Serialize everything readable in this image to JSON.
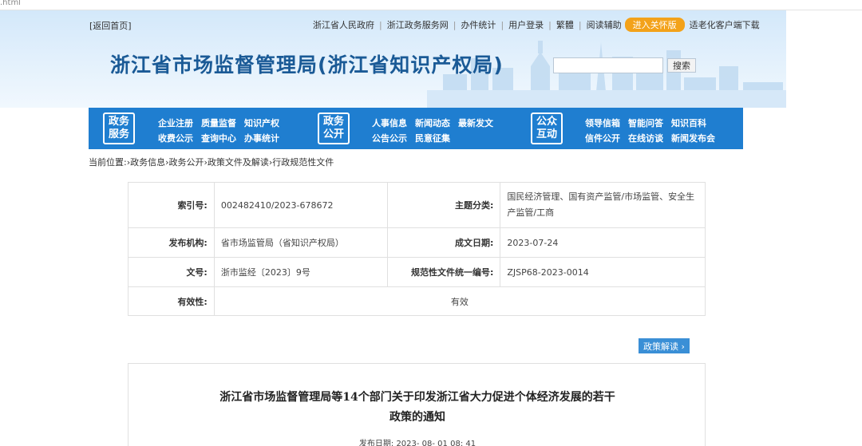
{
  "url_fragment": ".html",
  "header": {
    "back_home": "[返回首页]",
    "links": [
      "浙江省人民政府",
      "浙江政务服务网",
      "办件统计",
      "用户登录",
      "繁體",
      "阅读辅助"
    ],
    "care_mode": "进入关怀版",
    "client_download": "适老化客户端下载",
    "site_title": "浙江省市场监督管理局(浙江省知识产权局)",
    "search_placeholder": "",
    "search_button": "搜索"
  },
  "nav": {
    "groups": [
      {
        "badge_line1": "政务",
        "badge_line2": "服务",
        "row1": [
          "企业注册",
          "质量监督",
          "知识产权"
        ],
        "row2": [
          "收费公示",
          "查询中心",
          "办事统计"
        ]
      },
      {
        "badge_line1": "政务",
        "badge_line2": "公开",
        "row1": [
          "人事信息",
          "新闻动态",
          "最新发文"
        ],
        "row2": [
          "公告公示",
          "民意征集"
        ]
      },
      {
        "badge_line1": "公众",
        "badge_line2": "互动",
        "row1": [
          "领导信箱",
          "智能问答",
          "知识百科"
        ],
        "row2": [
          "信件公开",
          "在线访谈",
          "新闻发布会"
        ]
      }
    ]
  },
  "breadcrumb": "当前位置:›政务信息›政务公开›政策文件及解读›行政规范性文件",
  "info": {
    "index_label": "索引号:",
    "index_value": "002482410/2023-678672",
    "topic_label": "主题分类:",
    "topic_value": "国民经济管理、国有资产监管/市场监管、安全生产监管/工商",
    "publisher_label": "发布机构:",
    "publisher_value": "省市场监管局（省知识产权局）",
    "date_label": "成文日期:",
    "date_value": "2023-07-24",
    "docno_label": "文号:",
    "docno_value": "浙市监经〔2023〕9号",
    "code_label": "规范性文件统一编号:",
    "code_value": "ZJSP68-2023-0014",
    "validity_label": "有效性:",
    "validity_value": "有效"
  },
  "policy_button": "政策解读 ›",
  "document": {
    "title_line1": "浙江省市场监督管理局等14个部门关于印发浙江省大力促进个体经济发展的若干",
    "title_line2": "政策的通知",
    "publish_date": "发布日期: 2023- 08- 01 08: 41"
  }
}
